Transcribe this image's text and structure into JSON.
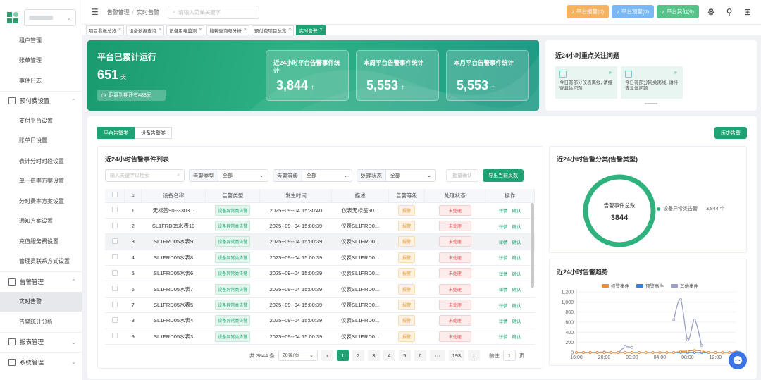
{
  "sidebar": {
    "items": [
      {
        "label": "租户管理",
        "kind": "item"
      },
      {
        "label": "账单管理",
        "kind": "item"
      },
      {
        "label": "事件日志",
        "kind": "item"
      },
      {
        "label": "预付费设置",
        "kind": "group",
        "icon": "tree-icon"
      },
      {
        "label": "支付平台设置",
        "kind": "item"
      },
      {
        "label": "账单日设置",
        "kind": "item"
      },
      {
        "label": "表计分时时段设置",
        "kind": "item"
      },
      {
        "label": "单一费率方案设置",
        "kind": "item"
      },
      {
        "label": "分时费率方案设置",
        "kind": "item"
      },
      {
        "label": "通知方案设置",
        "kind": "item"
      },
      {
        "label": "充值服务费设置",
        "kind": "item"
      },
      {
        "label": "管理员联系方式设置",
        "kind": "item"
      },
      {
        "label": "告警管理",
        "kind": "group",
        "icon": "clipboard-icon"
      },
      {
        "label": "实时告警",
        "kind": "item",
        "active": true
      },
      {
        "label": "告警统计分析",
        "kind": "item"
      },
      {
        "label": "报表管理",
        "kind": "group",
        "icon": "report-icon"
      },
      {
        "label": "系统管理",
        "kind": "group",
        "icon": "system-icon"
      }
    ]
  },
  "header": {
    "breadcrumb": [
      "告警管理",
      "实时告警"
    ],
    "search_placeholder": "请输入菜单关键字",
    "alerts": [
      {
        "label": "平台报警(0)",
        "color": "#f5b360"
      },
      {
        "label": "平台预警(0)",
        "color": "#7ab8f5"
      },
      {
        "label": "平台其他(0)",
        "color": "#56c48a"
      }
    ]
  },
  "tabs": [
    "项目看板总览",
    "设备数据查询",
    "设备用电监测",
    "能耗查询与分析",
    "预付费项目总览",
    "实时告警"
  ],
  "banner": {
    "title": "平台已累计运行",
    "days": "651",
    "days_unit": "天",
    "expire": "距离到期还有483天",
    "stats": [
      {
        "label": "近24小时平台告警事件统计",
        "value": "3,844"
      },
      {
        "label": "本周平台告警事件统计",
        "value": "5,553"
      },
      {
        "label": "本月平台告警事件统计",
        "value": "5,553"
      }
    ],
    "arrow": "↑"
  },
  "focus": {
    "title": "近24小时重点关注问题",
    "cards": [
      {
        "text": "今日有部分仪表离线, 请排查具体问题"
      },
      {
        "text": "今日有部分网关离线, 请排查具体问题"
      }
    ]
  },
  "main": {
    "segments": [
      "平台告警类",
      "设备告警类"
    ],
    "history_button": "历史告警",
    "list": {
      "title": "近24小时告警事件列表",
      "keyword_placeholder": "输入关键字以检索",
      "filters": [
        {
          "label": "告警类型",
          "value": "全部"
        },
        {
          "label": "告警等级",
          "value": "全部"
        },
        {
          "label": "处理状态",
          "value": "全部"
        }
      ],
      "batch_button": "批量确认",
      "export_button": "导出当前页数",
      "columns": [
        "#",
        "设备名称",
        "告警类型",
        "发生时间",
        "描述",
        "告警等级",
        "处理状态",
        "操作"
      ],
      "rows": [
        {
          "n": "1",
          "name": "无标签90--3303...",
          "type": "设备异常类告警",
          "time": "2025--09--04 15:30:40",
          "desc": "仪表无标签90...",
          "level": "报警",
          "status": "未处理"
        },
        {
          "n": "2",
          "name": "SL1FRD05水表10",
          "type": "设备异常类告警",
          "time": "2025--09--04 15:00:39",
          "desc": "仪表SL1FRD0...",
          "level": "报警",
          "status": "未处理"
        },
        {
          "n": "3",
          "name": "SL1FRD05水表9",
          "type": "设备异常类告警",
          "time": "2025--09--04 15:00:39",
          "desc": "仪表SL1FRD0...",
          "level": "报警",
          "status": "未处理"
        },
        {
          "n": "4",
          "name": "SL1FRD05水表8",
          "type": "设备异常类告警",
          "time": "2025--09--04 15:00:39",
          "desc": "仪表SL1FRD0...",
          "level": "报警",
          "status": "未处理"
        },
        {
          "n": "5",
          "name": "SL1FRD05水表6",
          "type": "设备异常类告警",
          "time": "2025--09--04 15:00:39",
          "desc": "仪表SL1FRD0...",
          "level": "报警",
          "status": "未处理"
        },
        {
          "n": "6",
          "name": "SL1FRD05水表7",
          "type": "设备异常类告警",
          "time": "2025--09--04 15:00:39",
          "desc": "仪表SL1FRD0...",
          "level": "报警",
          "status": "未处理"
        },
        {
          "n": "7",
          "name": "SL1FRD05水表5",
          "type": "设备异常类告警",
          "time": "2025--09--04 15:00:39",
          "desc": "仪表SL1FRD0...",
          "level": "报警",
          "status": "未处理"
        },
        {
          "n": "8",
          "name": "SL1FRD05水表4",
          "type": "设备异常类告警",
          "time": "2025--09--04 15:00:39",
          "desc": "仪表SL1FRD0...",
          "level": "报警",
          "status": "未处理"
        },
        {
          "n": "9",
          "name": "SL1FRD05水表3",
          "type": "设备异常类告警",
          "time": "2025--09--04 15:00:39",
          "desc": "仪表SL1FRD0...",
          "level": "报警",
          "status": "未处理"
        }
      ],
      "ops": [
        "详情",
        "确认"
      ],
      "pager": {
        "total": "共 3844 条",
        "page_size": "20条/页",
        "pages": [
          "1",
          "2",
          "3",
          "4",
          "5",
          "6",
          "···",
          "193"
        ],
        "goto_label": "前往",
        "goto_value": "1",
        "page_unit": "页"
      }
    }
  },
  "donut": {
    "title": "近24小时告警分类(告警类型)",
    "center_label": "告警事件总数",
    "center_value": "3844",
    "legend_name": "设备异常类告警",
    "legend_value": "3,844 个",
    "color": "#2fb27e"
  },
  "chart_data": {
    "type": "line",
    "title": "近24小时告警趋势",
    "x": [
      "16:00",
      "17:00",
      "18:00",
      "19:00",
      "20:00",
      "21:00",
      "22:00",
      "23:00",
      "00:00",
      "01:00",
      "02:00",
      "03:00",
      "04:00",
      "05:00",
      "06:00",
      "07:00",
      "08:00",
      "09:00",
      "10:00",
      "11:00",
      "12:00",
      "13:00",
      "14:00",
      "15:00"
    ],
    "xticks": [
      "16:00",
      "20:00",
      "00:00",
      "04:00",
      "08:00",
      "12:00"
    ],
    "yticks": [
      "0",
      "200",
      "400",
      "600",
      "800",
      "1,000",
      "1,200"
    ],
    "ylim": [
      0,
      1200
    ],
    "series": [
      {
        "name": "报警事件",
        "color": "#f58a2b",
        "values": [
          0,
          0,
          0,
          0,
          0,
          0,
          0,
          0,
          0,
          0,
          0,
          0,
          0,
          0,
          0,
          20,
          30,
          40,
          30,
          0,
          0,
          0,
          0,
          20
        ]
      },
      {
        "name": "预警事件",
        "color": "#2f7fe6",
        "values": [
          0,
          0,
          0,
          0,
          0,
          0,
          0,
          0,
          0,
          0,
          0,
          0,
          0,
          0,
          0,
          0,
          0,
          0,
          0,
          0,
          0,
          0,
          0,
          0
        ]
      },
      {
        "name": "其他事件",
        "color": "#9aa0c8",
        "values": [
          0,
          0,
          0,
          0,
          10,
          0,
          0,
          110,
          100,
          null,
          null,
          null,
          null,
          null,
          650,
          1050,
          250,
          640,
          140,
          null,
          null,
          null,
          null,
          null
        ]
      }
    ]
  }
}
